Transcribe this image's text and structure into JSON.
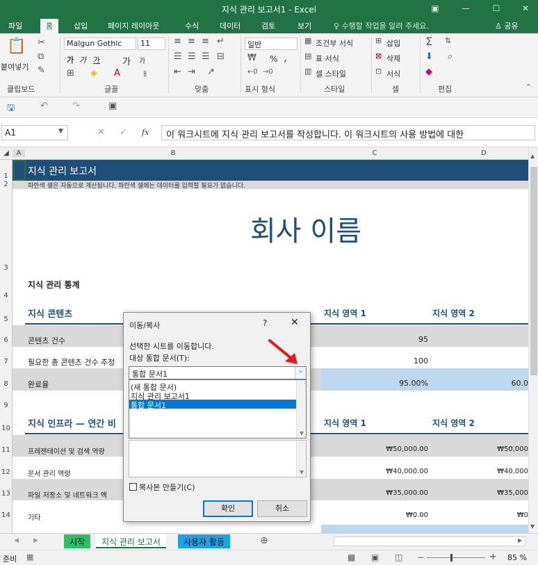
{
  "window": {
    "title": "지식 관리 보고서1 - Excel",
    "controls": [
      "▣",
      "—",
      "☐",
      "✕"
    ]
  },
  "ribbon_tabs": [
    "파일",
    "홈",
    "삽입",
    "페이지 레이아웃",
    "수식",
    "데이터",
    "검토",
    "보기"
  ],
  "active_tab": "홈",
  "tell_me": "수행할 작업을 알려 주세요.",
  "share": "공유",
  "ribbon": {
    "clipboard": {
      "paste": "붙여넣기",
      "label": "클립보드"
    },
    "font": {
      "name": "Malgun Gothic",
      "size": "11",
      "label": "글꼴",
      "bold": "가",
      "italic": "가",
      "underline": "가",
      "grow": "가",
      "shrink": "가"
    },
    "align": {
      "label": "맞춤"
    },
    "number": {
      "format": "일반",
      "percent": "%",
      "comma": ",",
      "label": "표시 형식"
    },
    "styles": {
      "conditional": "조건부 서식",
      "table": "표 서식",
      "cell_styles": "셀 스타일",
      "label": "스타일"
    },
    "cells": {
      "insert": "삽입",
      "delete": "삭제",
      "format": "서식",
      "label": "셀"
    },
    "editing": {
      "label": "편집"
    }
  },
  "formula_bar": {
    "name_box": "A1",
    "fx": "fx",
    "content": "이 워크시트에 지식 관리 보고서를 작성합니다. 이 워크시트의 사용 방법에 대한"
  },
  "columns": [
    "A",
    "B",
    "C",
    "D"
  ],
  "rows": [
    "1",
    "2",
    "3",
    "4",
    "5",
    "6",
    "7",
    "8",
    "9",
    "10",
    "11",
    "12",
    "13",
    "14"
  ],
  "sheet": {
    "header_title": "지식 관리 보고서",
    "subtitle": "파란색 셀은 자동으로 계산됩니다. 파란색 셀에는 데이터를 입력할 필요가 없습니다.",
    "company": "회사 이름",
    "stats_title": "지식 관리 통계",
    "content_section": "지식 콘텐츠",
    "area1": "지식 영역 1",
    "area2": "지식 영역 2",
    "row6_label": "콘텐츠 건수",
    "row6_c": "95",
    "row7_label": "필요한 총 콘텐츠 건수 추정",
    "row7_c": "100",
    "row8_label": "완료율",
    "row8_c": "95.00%",
    "row8_d": "60.0",
    "infra_section": "지식 인프라 — 연간 비",
    "area1b": "지식 영역 1",
    "area2b": "지식 영역 2",
    "row11_label": "프레젠테이션 및 검색 역량",
    "row11_c": "₩50,000.00",
    "row11_d": "₩50,000",
    "row12_label": "문서 관리 역량",
    "row12_c": "₩40,000.00",
    "row12_d": "₩40,000",
    "row13_label": "파일 저장소 및 네트워크 액",
    "row13_c": "₩35,000.00",
    "row13_d": "₩35,000",
    "row14_label": "기타",
    "row14_c": "₩0.00",
    "row14_d": "₩0"
  },
  "dialog": {
    "title": "이동/복사",
    "help": "?",
    "close": "✕",
    "instruction": "선택한 시트를 이동합니다.",
    "target_label": "대상 통합 문서(T):",
    "combo_value": "통합 문서1",
    "options": [
      "(새 통합 문서)",
      "지식 관리 보고서1",
      "통합 문서1"
    ],
    "selected_index": 2,
    "copy_label": "복사본 만들기(C)",
    "ok": "확인",
    "cancel": "취소"
  },
  "sheet_tabs": [
    "시작",
    "지식 관리 보고서",
    "사용자 활동"
  ],
  "status": {
    "ready": "준비",
    "zoom": "85 %"
  },
  "colors": {
    "excel_green": "#217346",
    "header_navy": "#1f4e79",
    "band_gray": "#d9d9d9",
    "calc_blue": "#bdd7ee",
    "tab_green": "#2dbe6c",
    "tab_blue": "#1aa3e8",
    "selection": "#0078d7",
    "arrow_red": "#e01b1b"
  }
}
